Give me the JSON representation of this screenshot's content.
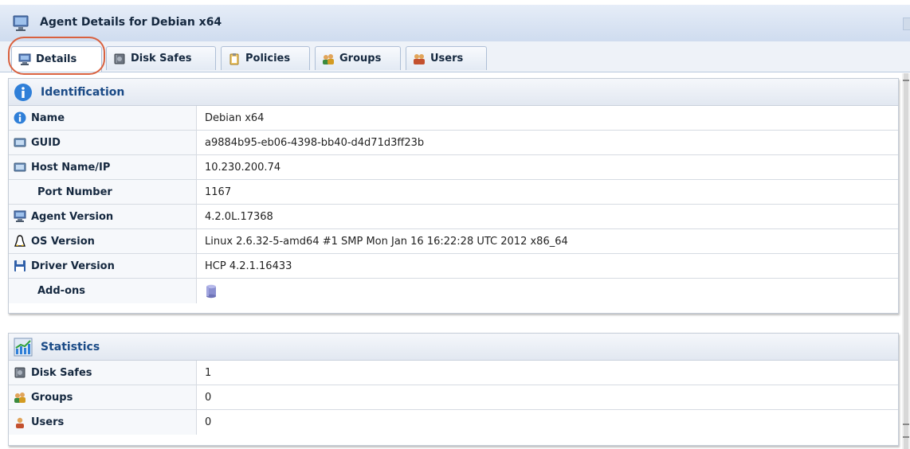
{
  "window": {
    "title": "Agent Details for Debian x64"
  },
  "tabs": [
    {
      "label": "Details",
      "icon": "computer-icon",
      "active": true
    },
    {
      "label": "Disk Safes",
      "icon": "disk-safe-icon",
      "active": false
    },
    {
      "label": "Policies",
      "icon": "clipboard-icon",
      "active": false
    },
    {
      "label": "Groups",
      "icon": "groups-icon",
      "active": false
    },
    {
      "label": "Users",
      "icon": "users-icon",
      "active": false
    }
  ],
  "identification": {
    "header": "Identification",
    "rows": [
      {
        "label": "Name",
        "value": "Debian x64",
        "icon": "info-icon"
      },
      {
        "label": "GUID",
        "value": "a9884b95-eb06-4398-bb40-d4d71d3ff23b",
        "icon": "network-icon"
      },
      {
        "label": "Host Name/IP",
        "value": "10.230.200.74",
        "icon": "network-icon"
      },
      {
        "label": "Port Number",
        "value": "1167",
        "icon": ""
      },
      {
        "label": "Agent Version",
        "value": "4.2.0L.17368",
        "icon": "computer-icon"
      },
      {
        "label": "OS Version",
        "value": "Linux 2.6.32-5-amd64 #1 SMP Mon Jan 16 16:22:28 UTC 2012 x86_64",
        "icon": "linux-icon"
      },
      {
        "label": "Driver Version",
        "value": "HCP 4.2.1.16433",
        "icon": "floppy-disk-icon"
      },
      {
        "label": "Add-ons",
        "value": "",
        "icon": "",
        "value_icon": "database-icon"
      }
    ]
  },
  "statistics": {
    "header": "Statistics",
    "rows": [
      {
        "label": "Disk Safes",
        "value": "1",
        "icon": "disk-safe-icon"
      },
      {
        "label": "Groups",
        "value": "0",
        "icon": "groups-icon"
      },
      {
        "label": "Users",
        "value": "0",
        "icon": "user-icon"
      }
    ]
  },
  "colors": {
    "header_text": "#1a4a86",
    "tab_highlight": "#d9613f",
    "title_bar": "#cfdcef"
  }
}
